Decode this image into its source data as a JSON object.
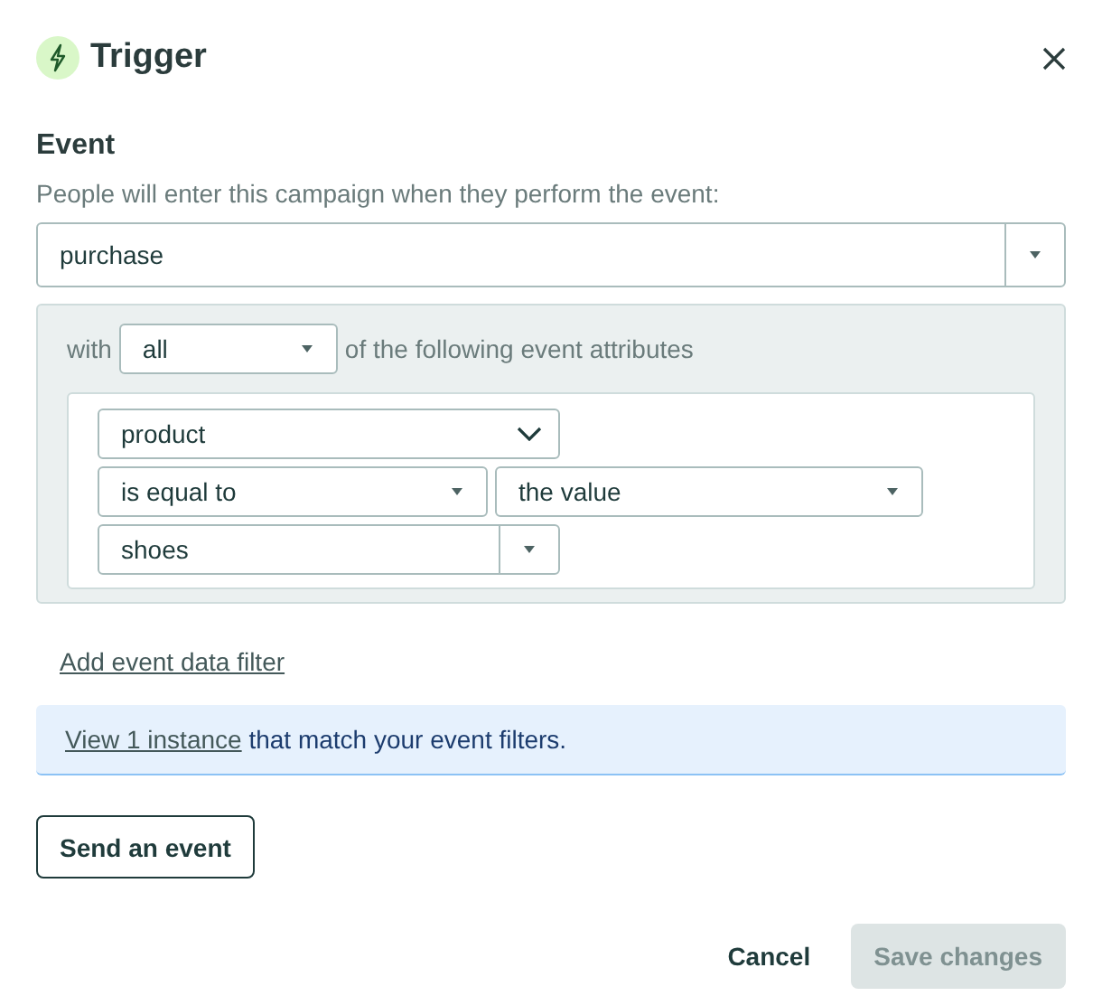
{
  "header": {
    "title": "Trigger"
  },
  "event": {
    "heading": "Event",
    "description": "People will enter this campaign when they perform the event:",
    "select": {
      "value": "purchase",
      "kind": "split"
    }
  },
  "filter": {
    "prefix": "with",
    "match": {
      "value": "all",
      "kind": "caret"
    },
    "suffix": "of the following event attributes",
    "rows": [
      [
        {
          "value": "product",
          "kind": "chevron"
        }
      ],
      [
        {
          "value": "is equal to",
          "kind": "caret"
        },
        {
          "value": "the value",
          "kind": "caret"
        }
      ],
      [
        {
          "value": "shoes",
          "kind": "split"
        }
      ]
    ]
  },
  "add_filter_link": "Add event data filter",
  "info": {
    "link": "View 1 instance",
    "text": "that match your event filters."
  },
  "send_button": "Send an event",
  "footer": {
    "cancel": "Cancel",
    "save": {
      "label": "Save changes",
      "disabled": true
    }
  }
}
